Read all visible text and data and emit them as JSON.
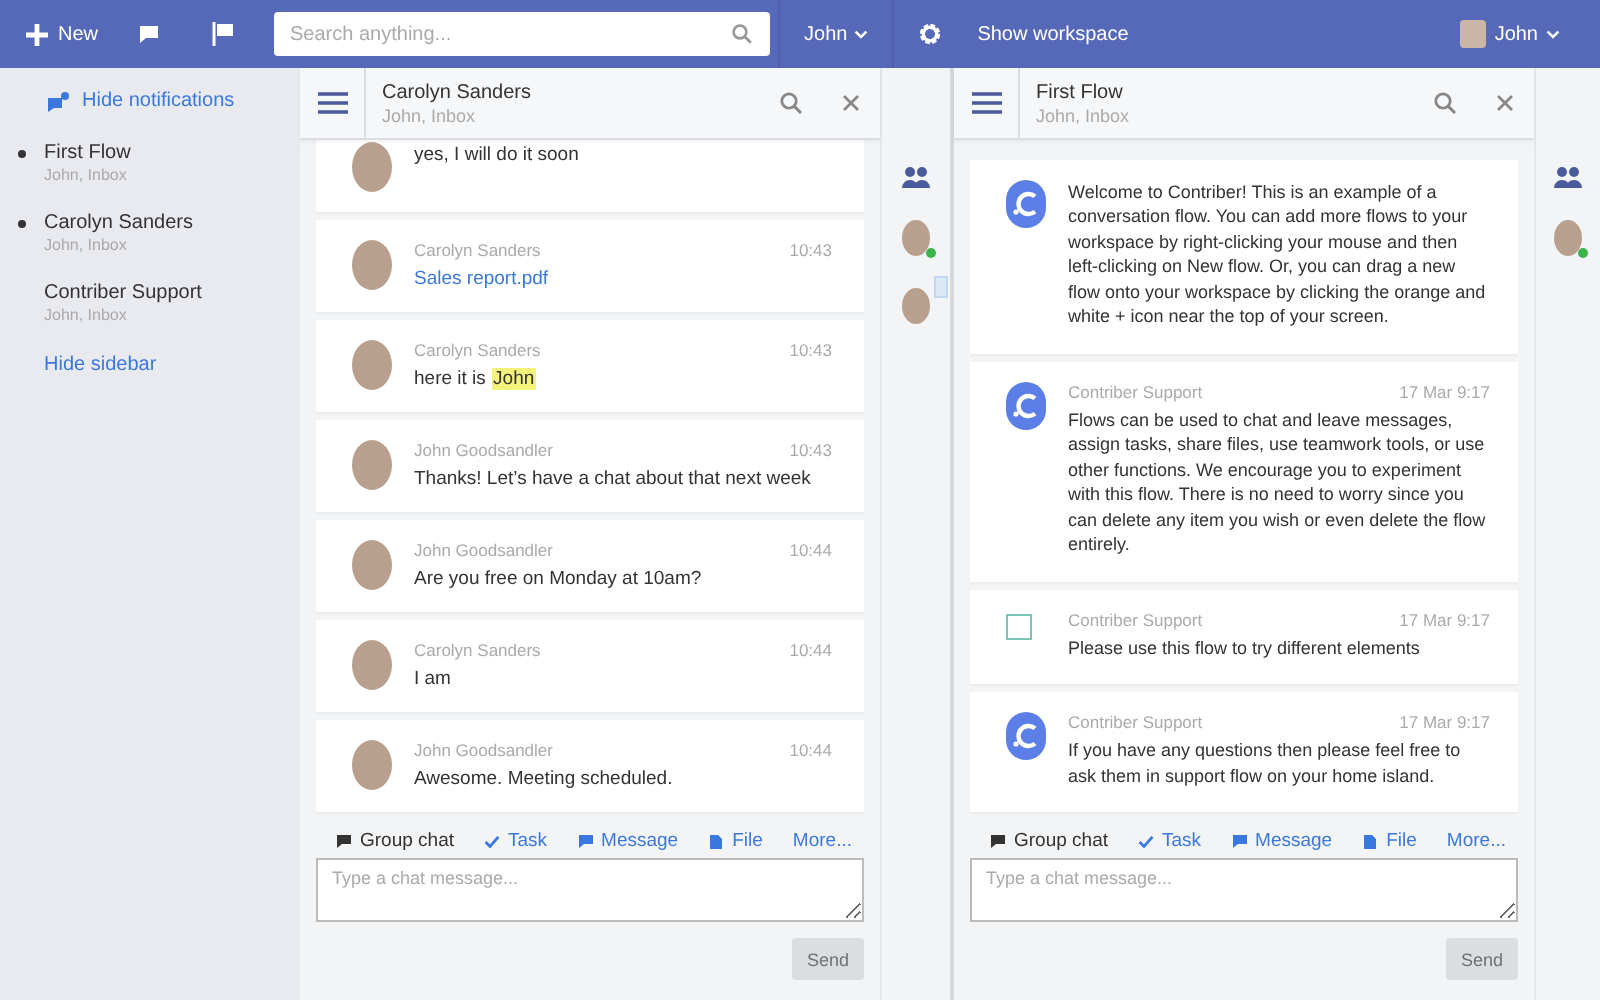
{
  "topbar": {
    "new_label": "New",
    "search": {
      "placeholder": "Search anything..."
    },
    "user_menu": "John",
    "workspace_button": "Show workspace",
    "account": "John"
  },
  "sidebar": {
    "hide_notifications": "Hide notifications",
    "items": [
      {
        "title": "First Flow",
        "subtitle": "John, Inbox",
        "unread": true
      },
      {
        "title": "Carolyn Sanders",
        "subtitle": "John, Inbox",
        "unread": true
      },
      {
        "title": "Contriber Support",
        "subtitle": "John, Inbox",
        "unread": false
      }
    ],
    "hide_sidebar": "Hide sidebar"
  },
  "panels": [
    {
      "title": "Carolyn Sanders",
      "subtitle": "John, Inbox",
      "messages": [
        {
          "kind": "avatar",
          "text": "yes, I will do it soon"
        },
        {
          "kind": "avatar",
          "author": "Carolyn Sanders",
          "time": "10:43",
          "link": "Sales report.pdf"
        },
        {
          "kind": "avatar",
          "author": "Carolyn Sanders",
          "time": "10:43",
          "text": "here it is ",
          "mention": "John"
        },
        {
          "kind": "avatar",
          "author": "John Goodsandler",
          "time": "10:43",
          "text": "Thanks! Let’s have a chat about that next week"
        },
        {
          "kind": "avatar",
          "author": "John Goodsandler",
          "time": "10:44",
          "text": "Are you free on Monday at 10am?"
        },
        {
          "kind": "avatar",
          "author": "Carolyn Sanders",
          "time": "10:44",
          "text": "I am"
        },
        {
          "kind": "avatar",
          "author": "John Goodsandler",
          "time": "10:44",
          "text": "Awesome. Meeting scheduled."
        }
      ],
      "composer": {
        "tabs": [
          {
            "label": "Group chat",
            "selected": true
          },
          {
            "label": "Task",
            "selected": false
          },
          {
            "label": "Message",
            "selected": false
          },
          {
            "label": "File",
            "selected": false
          },
          {
            "label": "More...",
            "selected": false
          }
        ],
        "placeholder": "Type a chat message...",
        "send": "Send"
      },
      "members": [
        {
          "online": true,
          "unread": false
        },
        {
          "online": false,
          "unread": true
        }
      ]
    },
    {
      "title": "First Flow",
      "subtitle": "John, Inbox",
      "messages": [
        {
          "kind": "logo",
          "text": "Welcome to Contriber! This is an example of a conversation flow. You can add more flows to your workspace by right-clicking your mouse and then left-clicking on New flow. Or, you can drag a new flow onto your workspace by clicking the orange and white + icon near the top of your screen."
        },
        {
          "kind": "logo",
          "author": "Contriber Support",
          "time": "17 Mar 9:17",
          "text": "Flows can be used to chat and leave messages, assign tasks, share files, use teamwork tools, or use other functions. We encourage you to experiment with this flow. There is no need to worry since you can delete any item you wish or even delete the flow entirely."
        },
        {
          "kind": "task",
          "checked": false,
          "author": "Contriber Support",
          "time": "17 Mar 9:17",
          "text": "Please use this flow to try different elements"
        },
        {
          "kind": "logo",
          "author": "Contriber Support",
          "time": "17 Mar 9:17",
          "text": "If you have any questions then please feel free to ask them in support flow on your home island."
        }
      ],
      "composer": {
        "tabs": [
          {
            "label": "Group chat",
            "selected": true
          },
          {
            "label": "Task",
            "selected": false
          },
          {
            "label": "Message",
            "selected": false
          },
          {
            "label": "File",
            "selected": false
          },
          {
            "label": "More...",
            "selected": false
          }
        ],
        "placeholder": "Type a chat message...",
        "send": "Send"
      },
      "members": [
        {
          "online": true,
          "unread": false
        }
      ]
    }
  ]
}
